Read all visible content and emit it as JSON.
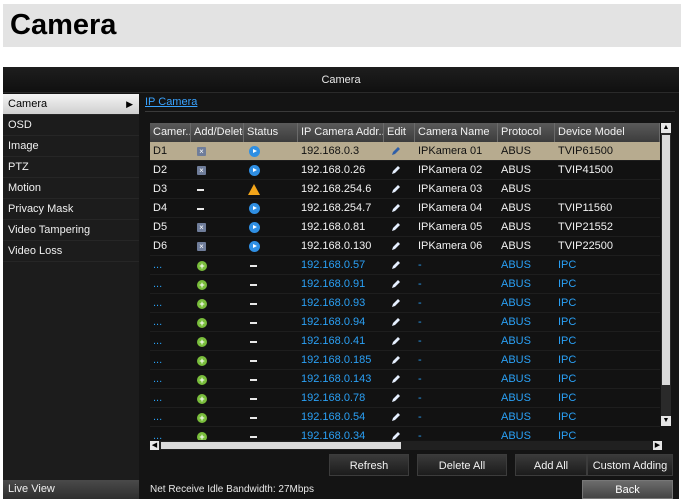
{
  "document": {
    "title": "Camera"
  },
  "window": {
    "title": "Camera"
  },
  "sidebar": {
    "items": [
      {
        "label": "Camera",
        "active": true
      },
      {
        "label": "OSD"
      },
      {
        "label": "Image"
      },
      {
        "label": "PTZ"
      },
      {
        "label": "Motion"
      },
      {
        "label": "Privacy Mask"
      },
      {
        "label": "Video Tampering"
      },
      {
        "label": "Video Loss"
      }
    ],
    "live_view": "Live View"
  },
  "tab": {
    "label": "IP Camera"
  },
  "table": {
    "columns": [
      "Camer...",
      "Add/Delete",
      "Status",
      "IP Camera Addr...",
      "Edit",
      "Camera Name",
      "Protocol",
      "Device Model"
    ],
    "rows": [
      {
        "cam": "D1",
        "add": "delete",
        "status": "online",
        "ip": "192.168.0.3",
        "name": "IPKamera 01",
        "protocol": "ABUS",
        "model": "TVIP61500",
        "type": "added",
        "selected": true
      },
      {
        "cam": "D2",
        "add": "delete",
        "status": "online",
        "ip": "192.168.0.26",
        "name": "IPKamera 02",
        "protocol": "ABUS",
        "model": "TVIP41500",
        "type": "added"
      },
      {
        "cam": "D3",
        "add": "none",
        "status": "warning",
        "ip": "192.168.254.6",
        "name": "IPKamera 03",
        "protocol": "ABUS",
        "model": "",
        "type": "added"
      },
      {
        "cam": "D4",
        "add": "none",
        "status": "online",
        "ip": "192.168.254.7",
        "name": "IPKamera 04",
        "protocol": "ABUS",
        "model": "TVIP11560",
        "type": "added"
      },
      {
        "cam": "D5",
        "add": "delete",
        "status": "online",
        "ip": "192.168.0.81",
        "name": "IPKamera 05",
        "protocol": "ABUS",
        "model": "TVIP21552",
        "type": "added"
      },
      {
        "cam": "D6",
        "add": "delete",
        "status": "online",
        "ip": "192.168.0.130",
        "name": "IPKamera 06",
        "protocol": "ABUS",
        "model": "TVIP22500",
        "type": "added"
      },
      {
        "cam": "...",
        "add": "add",
        "status": "none",
        "ip": "192.168.0.57",
        "name": "-",
        "protocol": "ABUS",
        "model": "IPC",
        "type": "found"
      },
      {
        "cam": "...",
        "add": "add",
        "status": "none",
        "ip": "192.168.0.91",
        "name": "-",
        "protocol": "ABUS",
        "model": "IPC",
        "type": "found"
      },
      {
        "cam": "...",
        "add": "add",
        "status": "none",
        "ip": "192.168.0.93",
        "name": "-",
        "protocol": "ABUS",
        "model": "IPC",
        "type": "found"
      },
      {
        "cam": "...",
        "add": "add",
        "status": "none",
        "ip": "192.168.0.94",
        "name": "-",
        "protocol": "ABUS",
        "model": "IPC",
        "type": "found"
      },
      {
        "cam": "...",
        "add": "add",
        "status": "none",
        "ip": "192.168.0.41",
        "name": "-",
        "protocol": "ABUS",
        "model": "IPC",
        "type": "found"
      },
      {
        "cam": "...",
        "add": "add",
        "status": "none",
        "ip": "192.168.0.185",
        "name": "-",
        "protocol": "ABUS",
        "model": "IPC",
        "type": "found"
      },
      {
        "cam": "...",
        "add": "add",
        "status": "none",
        "ip": "192.168.0.143",
        "name": "-",
        "protocol": "ABUS",
        "model": "IPC",
        "type": "found"
      },
      {
        "cam": "...",
        "add": "add",
        "status": "none",
        "ip": "192.168.0.78",
        "name": "-",
        "protocol": "ABUS",
        "model": "IPC",
        "type": "found"
      },
      {
        "cam": "...",
        "add": "add",
        "status": "none",
        "ip": "192.168.0.54",
        "name": "-",
        "protocol": "ABUS",
        "model": "IPC",
        "type": "found"
      },
      {
        "cam": "...",
        "add": "add",
        "status": "none",
        "ip": "192.168.0.34",
        "name": "-",
        "protocol": "ABUS",
        "model": "IPC",
        "type": "found"
      }
    ]
  },
  "buttons": {
    "refresh": "Refresh",
    "delete_all": "Delete All",
    "add_all": "Add All",
    "custom_adding": "Custom Adding",
    "back": "Back"
  },
  "status_bar": {
    "bandwidth": "Net Receive Idle Bandwidth: 27Mbps"
  },
  "colors": {
    "selected_row": "#b7ab8f",
    "found_text": "#2aa0f5",
    "add_icon": "#79bd3b",
    "status_online": "#2f8fe3",
    "status_warning": "#f3a51a"
  }
}
